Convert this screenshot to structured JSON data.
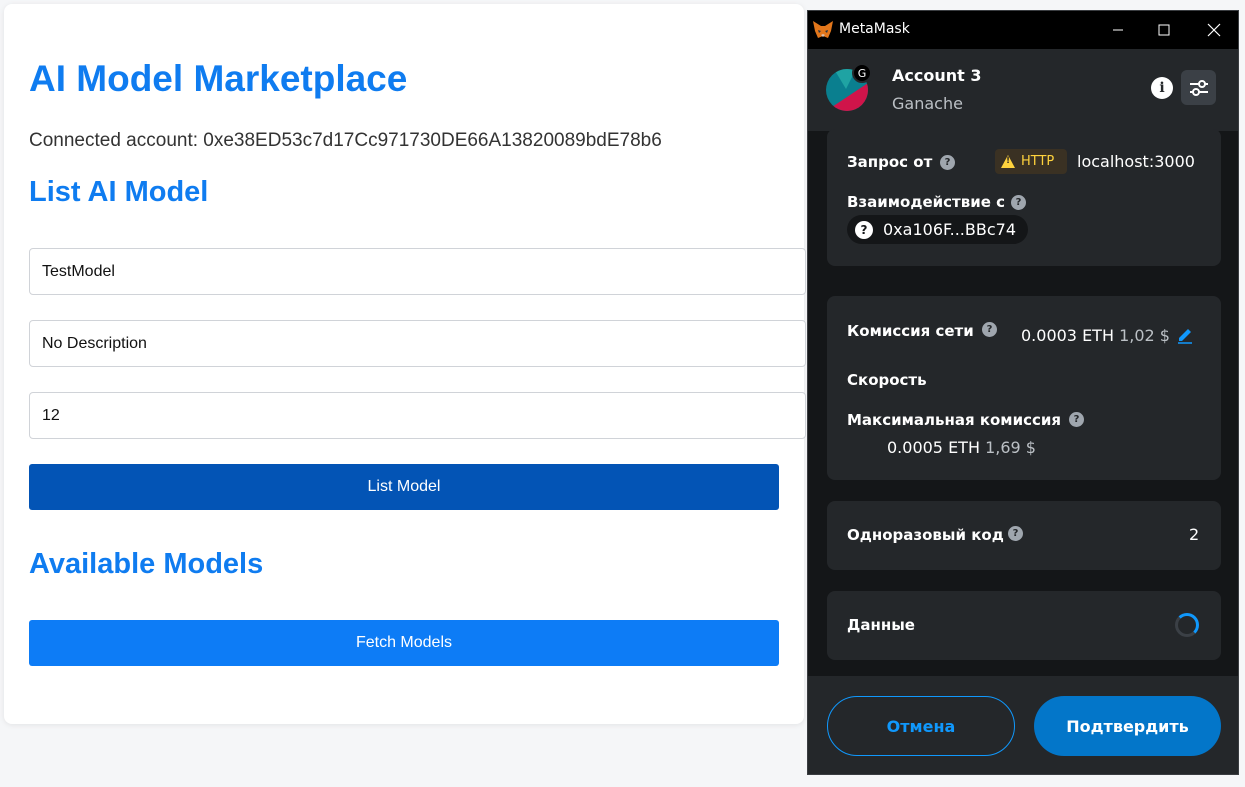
{
  "app": {
    "title": "AI Model Marketplace",
    "connected_account": "Connected account: 0xe38ED53c7d17Cc971730DE66A13820089bdE78b6",
    "list_section_title": "List AI Model",
    "name_value": "TestModel",
    "description_value": "No Description",
    "price_value": "12",
    "list_button": "List Model",
    "available_section_title": "Available Models",
    "fetch_button": "Fetch Models",
    "colors": {
      "title": "#0f7cf0",
      "list_button_bg": "#0354b5",
      "fetch_button_bg": "#0d7cf6"
    }
  },
  "metamask": {
    "window_title": "MetaMask",
    "account_name": "Account 3",
    "network": "Ganache",
    "network_badge": "G",
    "request_from_label": "Запрос от",
    "http_badge": "HTTP",
    "origin": "localhost:3000",
    "interacting_with_label": "Взаимодействие с",
    "contract_address": "0xa106F...BBc74",
    "network_fee_label": "Комиссия сети",
    "network_fee_eth": "0.0003 ETH",
    "network_fee_fiat": "1,02 $",
    "speed_label": "Скорость",
    "max_fee_label": "Максимальная комиссия",
    "max_fee_eth": "0.0005 ETH",
    "max_fee_fiat": "1,69 $",
    "nonce_label": "Одноразовый код",
    "nonce_value": "2",
    "data_label": "Данные",
    "cancel_button": "Отмена",
    "confirm_button": "Подтвердить",
    "colors": {
      "primary": "#1098fc",
      "panel": "#24272a",
      "background": "#141618",
      "warning": "#ffd33d"
    }
  }
}
